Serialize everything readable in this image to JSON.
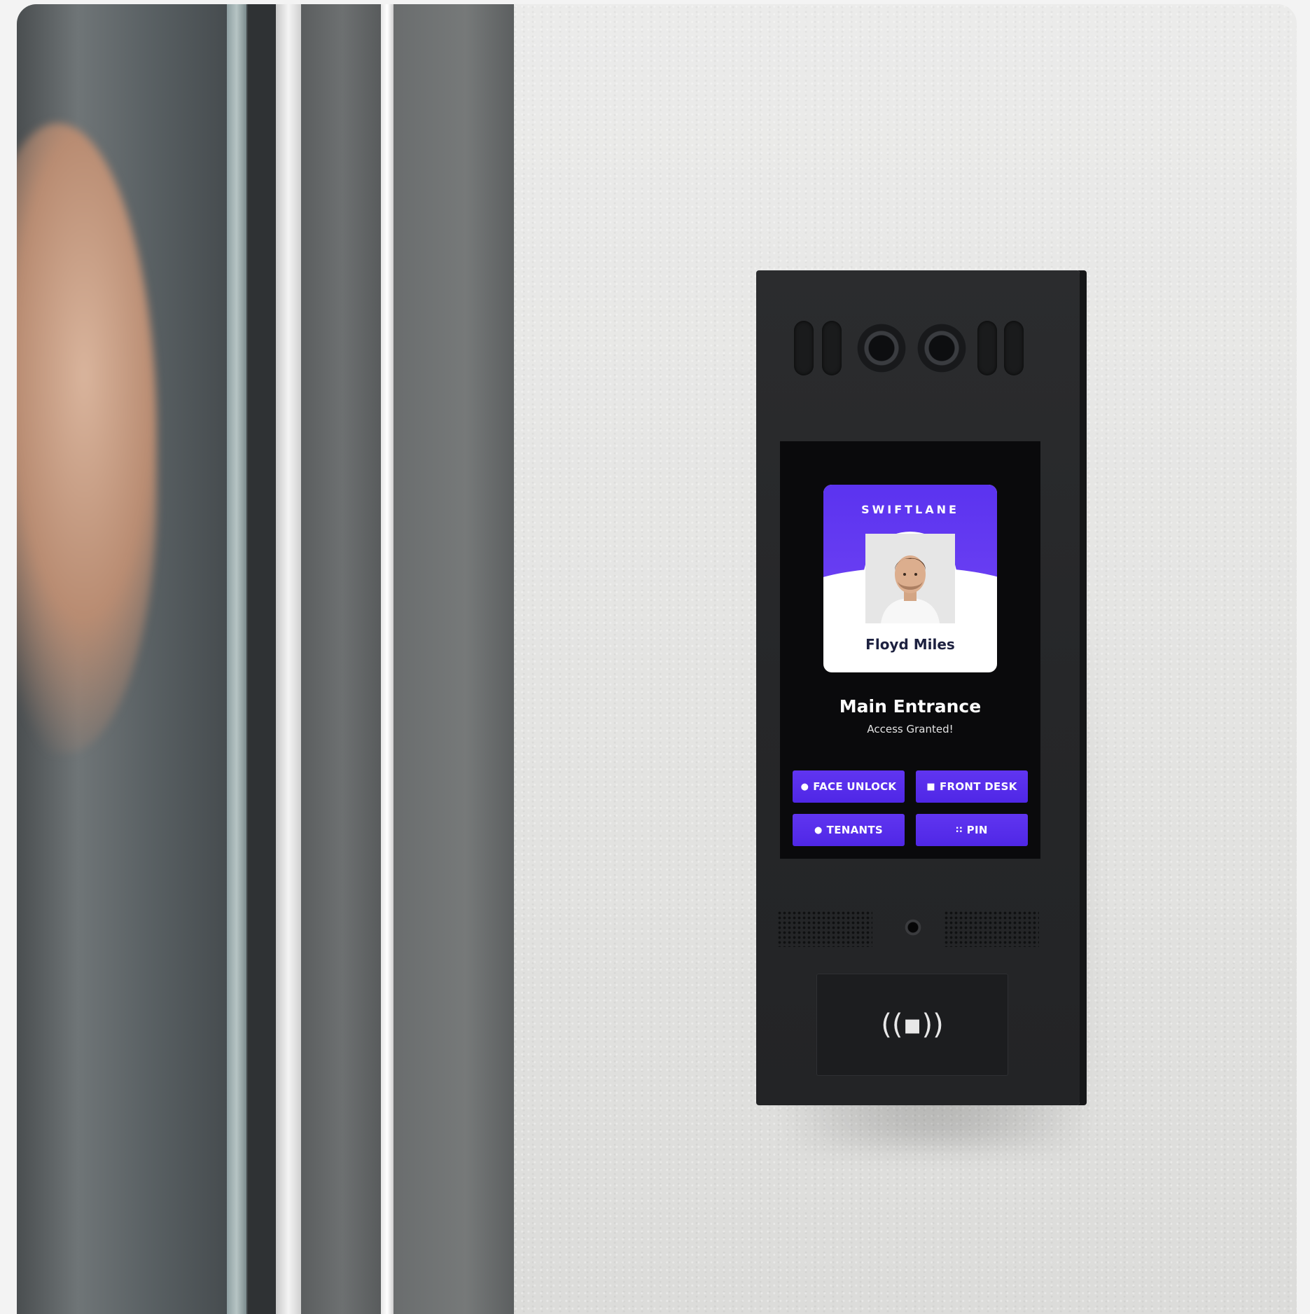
{
  "card": {
    "brand": "SWIFTLANE",
    "name": "Floyd Miles"
  },
  "entry": {
    "location": "Main Entrance",
    "status": "Access Granted!"
  },
  "buttons": [
    {
      "label": "FACE UNLOCK",
      "icon": "person-icon"
    },
    {
      "label": "FRONT DESK",
      "icon": "video-icon"
    },
    {
      "label": "TENANTS",
      "icon": "people-icon"
    },
    {
      "label": "PIN",
      "icon": "keypad-icon"
    }
  ],
  "reader": {
    "symbol": "((▪))",
    "icon": "nfc-icon"
  },
  "colors": {
    "accent": "#5b33f0",
    "device": "#262729",
    "screen": "#0a0a0c"
  }
}
